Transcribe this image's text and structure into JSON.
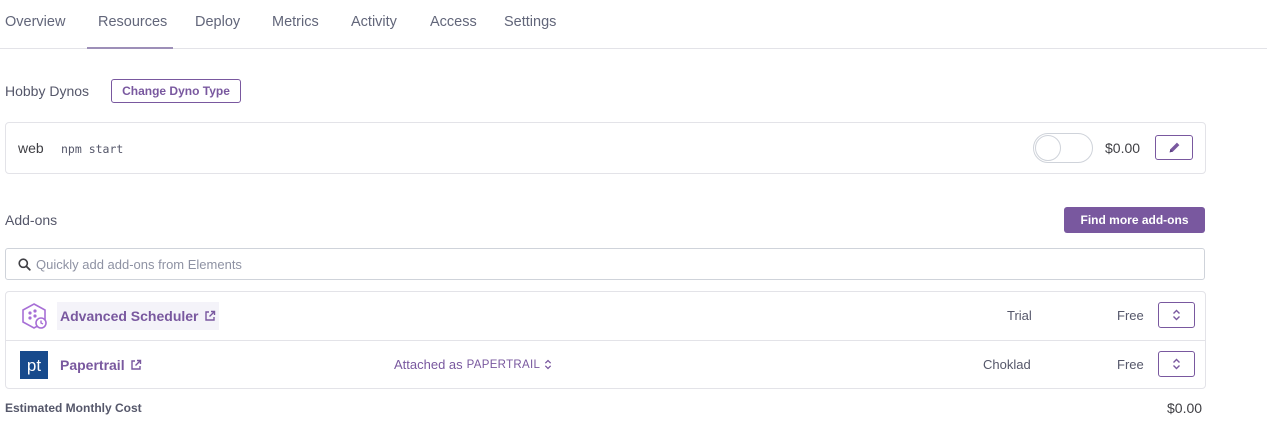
{
  "tabs": [
    {
      "label": "Overview"
    },
    {
      "label": "Resources",
      "active": true
    },
    {
      "label": "Deploy"
    },
    {
      "label": "Metrics"
    },
    {
      "label": "Activity"
    },
    {
      "label": "Access"
    },
    {
      "label": "Settings"
    }
  ],
  "dynos": {
    "title": "Hobby Dynos",
    "change_button": "Change Dyno Type",
    "items": [
      {
        "name": "web",
        "command": "npm start",
        "price": "$0.00",
        "enabled": false
      }
    ]
  },
  "addons": {
    "title": "Add-ons",
    "find_button": "Find more add-ons",
    "search_placeholder": "Quickly add add-ons from Elements",
    "items": [
      {
        "name": "Advanced Scheduler",
        "attached": "",
        "plan": "Trial",
        "cost": "Free",
        "icon": "scheduler-icon"
      },
      {
        "name": "Papertrail",
        "attached_prefix": "Attached as",
        "attached_var": "PAPERTRAIL",
        "plan": "Choklad",
        "cost": "Free",
        "icon": "papertrail-logo"
      }
    ]
  },
  "footer": {
    "label": "Estimated Monthly Cost",
    "total": "$0.00"
  },
  "colors": {
    "accent": "#79589f",
    "border": "#e3e3e8",
    "text": "#3f3f44"
  }
}
